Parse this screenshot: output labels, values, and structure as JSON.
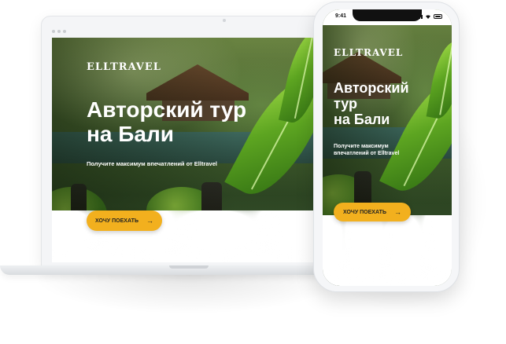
{
  "desktop": {
    "logo": "ELLTRAVEL",
    "headline_line1": "Авторский тур",
    "headline_line2": "на Бали",
    "subline": "Получите максимум впечатлений от Elltravel",
    "cta_label": "ХОЧУ ПОЕХАТЬ",
    "cta_icon": "arrow-right-icon"
  },
  "mobile": {
    "status_time": "9:41",
    "logo": "ELLTRAVEL",
    "headline_line1": "Авторский",
    "headline_line2": "тур",
    "headline_line3": "на Бали",
    "subline_line1": "Получите максимум",
    "subline_line2": "впечатлений от Elltravel",
    "cta_label": "ХОЧУ ПОЕХАТЬ",
    "cta_icon": "arrow-right-icon"
  },
  "colors": {
    "accent": "#f2b01e",
    "text_on_hero": "#ffffff"
  }
}
